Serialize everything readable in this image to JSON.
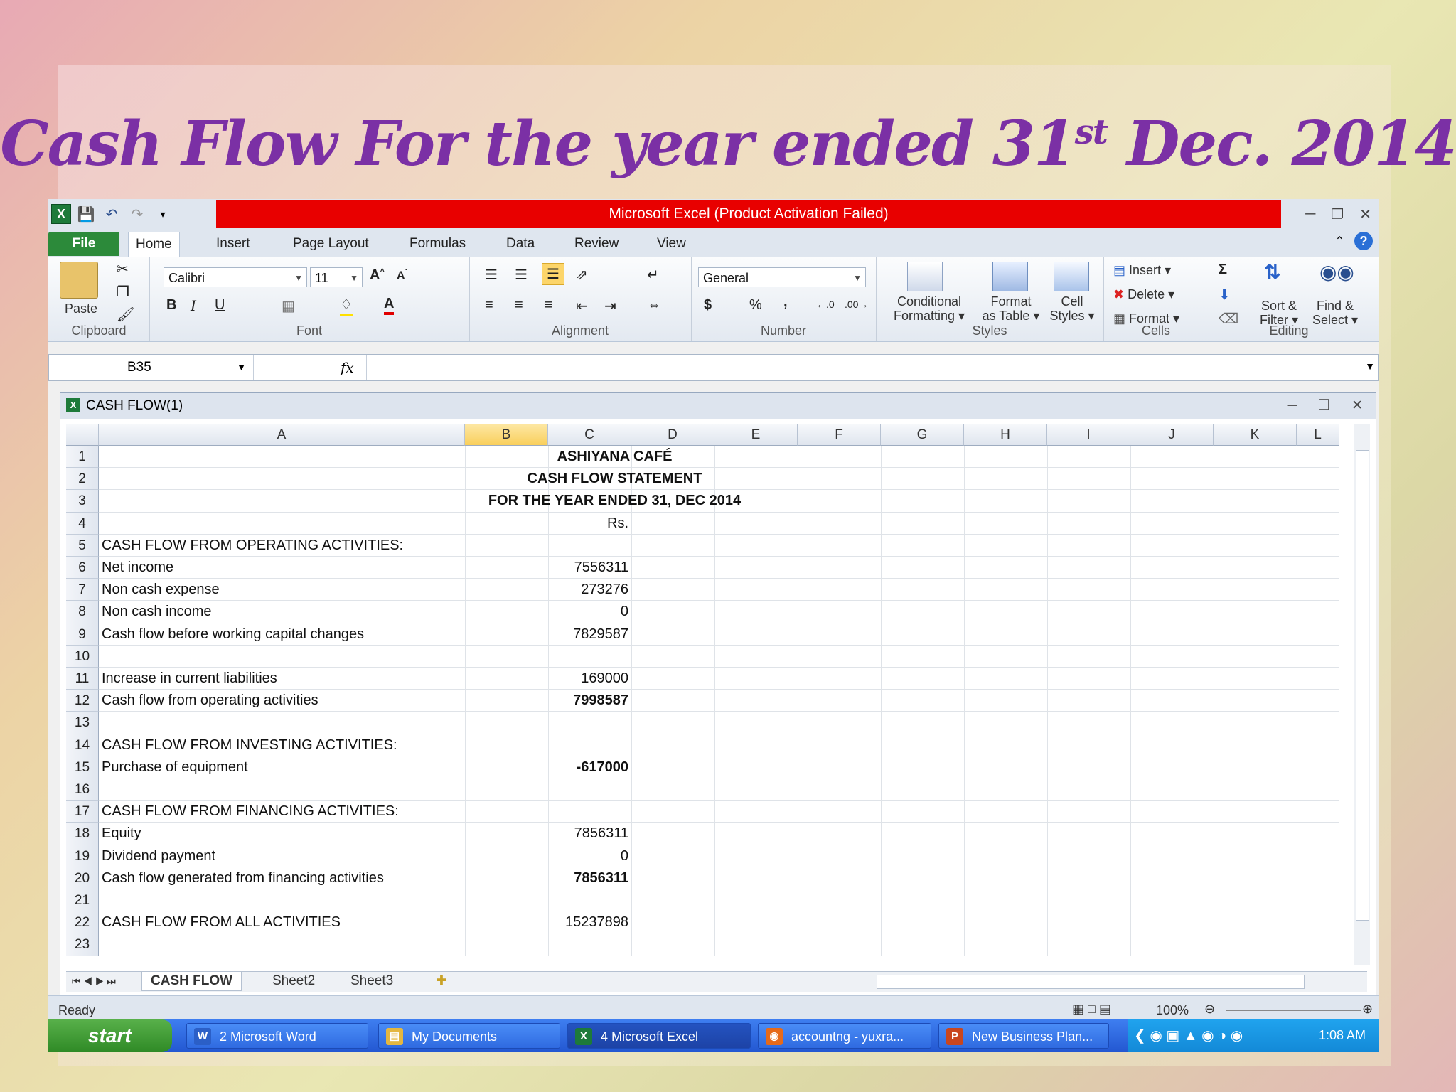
{
  "slide": {
    "title_main": "Cash Flow For the year ended 31",
    "title_sup": "st",
    "title_end": " Dec. 2014"
  },
  "excel": {
    "window_title": "Microsoft Excel (Product Activation Failed)",
    "tabs": [
      "File",
      "Home",
      "Insert",
      "Page Layout",
      "Formulas",
      "Data",
      "Review",
      "View"
    ],
    "ribbon": {
      "clipboard": {
        "paste": "Paste",
        "label": "Clipboard"
      },
      "font": {
        "name": "Calibri",
        "size": "11",
        "label": "Font"
      },
      "alignment": {
        "label": "Alignment"
      },
      "number": {
        "format": "General",
        "label": "Number",
        "currency": "$",
        "percent": "%",
        "comma": ","
      },
      "styles": {
        "conditional": "Conditional",
        "conditional2": "Formatting",
        "format_table": "Format",
        "format_table2": "as Table",
        "cell_styles": "Cell",
        "cell_styles2": "Styles",
        "label": "Styles"
      },
      "cells": {
        "insert": "Insert",
        "delete": "Delete",
        "format": "Format",
        "label": "Cells"
      },
      "editing": {
        "sort": "Sort &",
        "sort2": "Filter",
        "find": "Find &",
        "find2": "Select",
        "label": "Editing"
      }
    },
    "name_box": "B35",
    "fx": "fx",
    "workbook_title": "CASH FLOW(1)",
    "columns": [
      "A",
      "B",
      "C",
      "D",
      "E",
      "F",
      "G",
      "H",
      "I",
      "J",
      "K",
      "L"
    ],
    "selected_column": "B",
    "rows": [
      {
        "n": "1",
        "a": "",
        "c": "",
        "center": "ASHIYANA CAFÉ",
        "bold": false
      },
      {
        "n": "2",
        "a": "",
        "c": "",
        "center": "CASH FLOW STATEMENT",
        "bold": false
      },
      {
        "n": "3",
        "a": "",
        "c": "",
        "center": "FOR THE YEAR ENDED 31, DEC 2014",
        "bold": false
      },
      {
        "n": "4",
        "a": "",
        "c": "Rs.",
        "center": "",
        "bold": false
      },
      {
        "n": "5",
        "a": "CASH FLOW FROM OPERATING ACTIVITIES:",
        "c": "",
        "center": "",
        "bold": false
      },
      {
        "n": "6",
        "a": "Net income",
        "c": "7556311",
        "center": "",
        "bold": false
      },
      {
        "n": "7",
        "a": "Non cash expense",
        "c": "273276",
        "center": "",
        "bold": false
      },
      {
        "n": "8",
        "a": "Non cash income",
        "c": "0",
        "center": "",
        "bold": false
      },
      {
        "n": "9",
        "a": "Cash flow before working capital changes",
        "c": "7829587",
        "center": "",
        "bold": false
      },
      {
        "n": "10",
        "a": "",
        "c": "",
        "center": "",
        "bold": false
      },
      {
        "n": "11",
        "a": "Increase in current liabilities",
        "c": "169000",
        "center": "",
        "bold": false
      },
      {
        "n": "12",
        "a": "Cash flow from operating activities",
        "c": "7998587",
        "center": "",
        "bold": true
      },
      {
        "n": "13",
        "a": "",
        "c": "",
        "center": "",
        "bold": false
      },
      {
        "n": "14",
        "a": "CASH FLOW FROM INVESTING ACTIVITIES:",
        "c": "",
        "center": "",
        "bold": false
      },
      {
        "n": "15",
        "a": "Purchase of equipment",
        "c": "-617000",
        "center": "",
        "bold": true
      },
      {
        "n": "16",
        "a": "",
        "c": "",
        "center": "",
        "bold": false
      },
      {
        "n": "17",
        "a": "CASH FLOW FROM FINANCING ACTIVITIES:",
        "c": "",
        "center": "",
        "bold": false
      },
      {
        "n": "18",
        "a": "Equity",
        "c": "7856311",
        "center": "",
        "bold": false
      },
      {
        "n": "19",
        "a": "Dividend payment",
        "c": "0",
        "center": "",
        "bold": false
      },
      {
        "n": "20",
        "a": "Cash flow generated from financing activities",
        "c": "7856311",
        "center": "",
        "bold": true
      },
      {
        "n": "21",
        "a": "",
        "c": "",
        "center": "",
        "bold": false
      },
      {
        "n": "22",
        "a": "CASH FLOW FROM ALL ACTIVITIES",
        "c": "15237898",
        "center": "",
        "bold": false
      },
      {
        "n": "23",
        "a": "",
        "c": "",
        "center": "",
        "bold": false
      }
    ],
    "sheets": [
      "CASH FLOW",
      "Sheet2",
      "Sheet3"
    ],
    "status": "Ready",
    "zoom": "100%"
  },
  "taskbar": {
    "start": "start",
    "buttons": [
      {
        "label": "2 Microsoft Word",
        "icon": "W",
        "color": "#2b5fc7"
      },
      {
        "label": "My Documents",
        "icon": "▤",
        "color": "#e4b740"
      },
      {
        "label": "4 Microsoft Excel",
        "icon": "X",
        "color": "#1d7a3a"
      },
      {
        "label": "accountng - yuxra...",
        "icon": "◉",
        "color": "#e66a1a"
      },
      {
        "label": "New Business Plan...",
        "icon": "P",
        "color": "#c9461e"
      }
    ],
    "time": "1:08 AM"
  }
}
